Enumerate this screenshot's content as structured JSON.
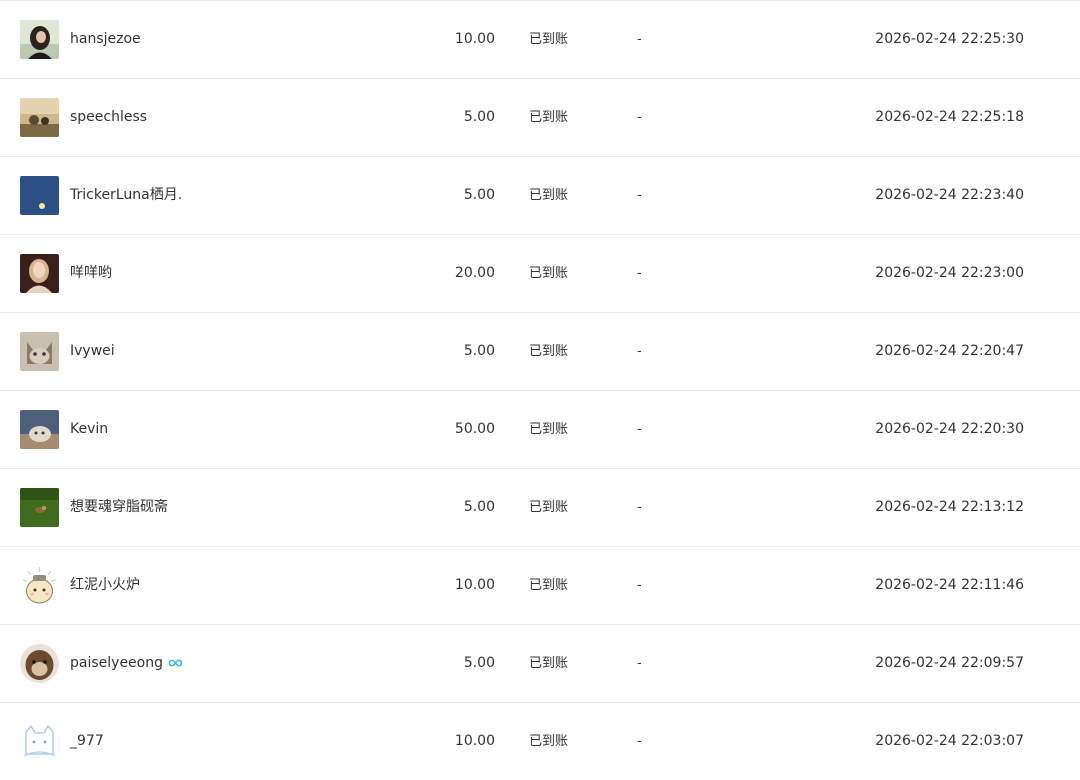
{
  "rows": [
    {
      "name": "hansjezoe",
      "amount": "10.00",
      "status": "已到账",
      "remark": "-",
      "time": "2026-02-24 22:25:30"
    },
    {
      "name": "speechless",
      "amount": "5.00",
      "status": "已到账",
      "remark": "-",
      "time": "2026-02-24 22:25:18"
    },
    {
      "name": "TrickerLuna栖月.",
      "amount": "5.00",
      "status": "已到账",
      "remark": "-",
      "time": "2026-02-24 22:23:40"
    },
    {
      "name": "咩咩哟",
      "amount": "20.00",
      "status": "已到账",
      "remark": "-",
      "time": "2026-02-24 22:23:00"
    },
    {
      "name": "Ivywei",
      "amount": "5.00",
      "status": "已到账",
      "remark": "-",
      "time": "2026-02-24 22:20:47"
    },
    {
      "name": "Kevin",
      "amount": "50.00",
      "status": "已到账",
      "remark": "-",
      "time": "2026-02-24 22:20:30"
    },
    {
      "name": "想要魂穿脂砚斋",
      "amount": "5.00",
      "status": "已到账",
      "remark": "-",
      "time": "2026-02-24 22:13:12"
    },
    {
      "name": "红泥小火炉",
      "amount": "10.00",
      "status": "已到账",
      "remark": "-",
      "time": "2026-02-24 22:11:46"
    },
    {
      "name": "paiselyeeong",
      "amount": "5.00",
      "status": "已到账",
      "remark": "-",
      "time": "2026-02-24 22:09:57",
      "badge_icon": "infinity-badge-icon",
      "badge_color": "#3fb6e8"
    },
    {
      "name": "_977",
      "amount": "10.00",
      "status": "已到账",
      "remark": "-",
      "time": "2026-02-24 22:03:07"
    }
  ]
}
